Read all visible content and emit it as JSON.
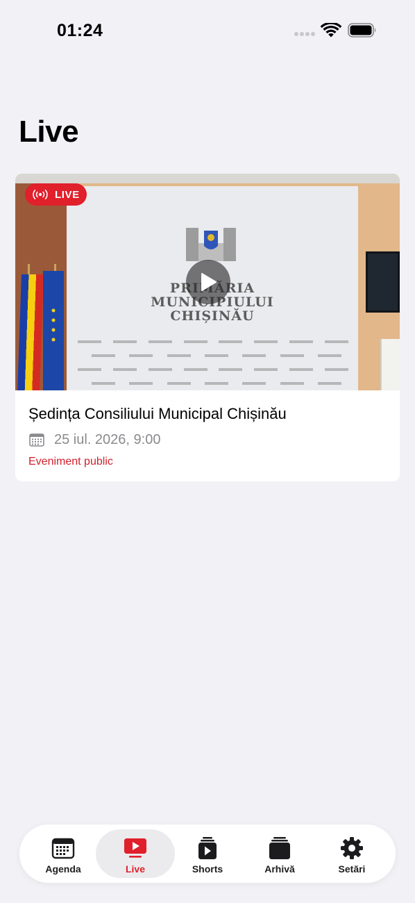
{
  "status_bar": {
    "time": "01:24"
  },
  "page": {
    "title": "Live"
  },
  "live_card": {
    "badge": "LIVE",
    "title": "Ședința Consiliului Municipal Chișinău",
    "date": "25 iul. 2026, 9:00",
    "tag": "Eveniment public",
    "thumbnail_text": [
      "PRIMĂRIA",
      "MUNICIPIULUI",
      "CHIȘINĂU"
    ]
  },
  "tabs": [
    {
      "label": "Agenda",
      "icon": "calendar-icon",
      "active": false
    },
    {
      "label": "Live",
      "icon": "tv-play-icon",
      "active": true
    },
    {
      "label": "Shorts",
      "icon": "shorts-play-icon",
      "active": false
    },
    {
      "label": "Arhivă",
      "icon": "stack-icon",
      "active": false
    },
    {
      "label": "Setări",
      "icon": "gear-icon",
      "active": false
    }
  ],
  "colors": {
    "accent": "#e0202b",
    "background": "#f2f1f6",
    "secondary_text": "#8a8a8e"
  }
}
